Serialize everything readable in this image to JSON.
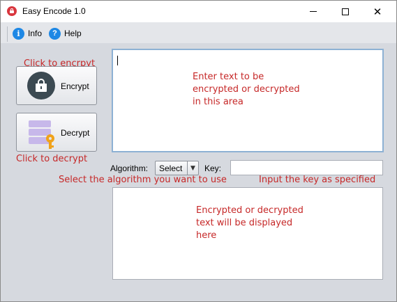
{
  "window": {
    "title": "Easy Encode 1.0",
    "app_icon": "lock-icon"
  },
  "titlebar_controls": {
    "minimize": "minimize",
    "maximize": "maximize",
    "close": "✕"
  },
  "menu": {
    "info": {
      "label": "Info",
      "icon": "info-icon"
    },
    "help": {
      "label": "Help",
      "icon": "help-icon"
    }
  },
  "annotations": {
    "encrypt_hint": "Click to encrpyt",
    "decrypt_hint": "Click to decrypt",
    "input_hint": "Enter text to be encrypted or decrypted in this area",
    "algorithm_hint": "Select the algorithm you want to use",
    "key_hint": "Input the key as specified by algorithm chosen",
    "output_hint": "Encrypted or decrypted text will be displayed here"
  },
  "buttons": {
    "encrypt": {
      "label": "Encrypt",
      "icon": "lock-icon"
    },
    "decrypt": {
      "label": "Decrypt",
      "icon": "database-key-icon"
    }
  },
  "form": {
    "algorithm_label": "Algorithm:",
    "algorithm_value": "Select",
    "algorithm_arrow": "▼",
    "key_label": "Key:",
    "key_value": ""
  },
  "colors": {
    "annotation": "#c62828",
    "accent": "#1e88e5",
    "lock_circle": "#3c4a52",
    "key": "#f0a21a"
  }
}
